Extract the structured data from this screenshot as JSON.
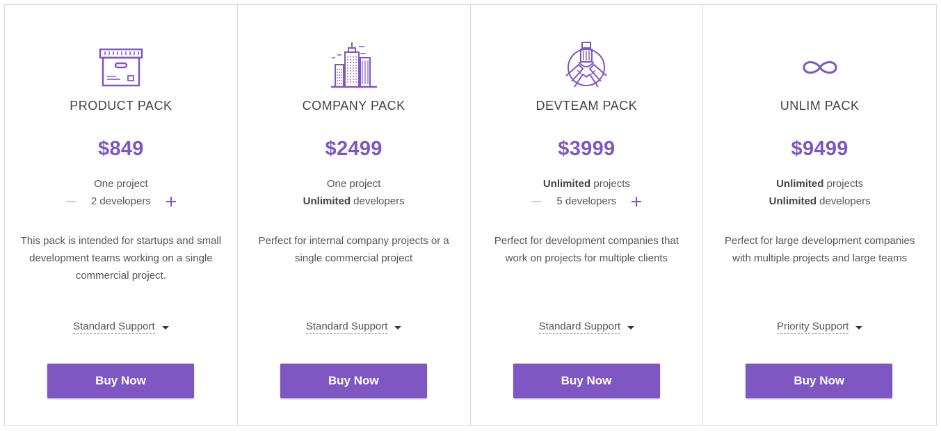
{
  "accent_color": "#7e57c2",
  "packs": [
    {
      "icon": "archive-box-icon",
      "title": "PRODUCT PACK",
      "price": "$849",
      "line1": {
        "text": "One project"
      },
      "line2": {
        "stepper": true,
        "count": "2 developers"
      },
      "description": "This pack is intended for startups and small development teams working on a single commercial project.",
      "support": "Standard Support",
      "button": "Buy Now"
    },
    {
      "icon": "office-buildings-icon",
      "title": "COMPANY PACK",
      "price": "$2499",
      "line1": {
        "text": "One project"
      },
      "line2": {
        "bold": "Unlimited",
        "rest": " developers"
      },
      "description": "Perfect for internal company projects or a single commercial project",
      "support": "Standard Support",
      "button": "Buy Now"
    },
    {
      "icon": "team-hands-icon",
      "title": "DEVTEAM PACK",
      "price": "$3999",
      "line1": {
        "bold": "Unlimited",
        "rest": " projects"
      },
      "line2": {
        "stepper": true,
        "count": "5 developers"
      },
      "description": "Perfect for development companies that work on projects for multiple clients",
      "support": "Standard Support",
      "button": "Buy Now"
    },
    {
      "icon": "infinity-icon",
      "title": "UNLIM PACK",
      "price": "$9499",
      "line1": {
        "bold": "Unlimited",
        "rest": " projects"
      },
      "line2": {
        "bold": "Unlimited",
        "rest": " developers"
      },
      "description": "Perfect for large development companies with multiple projects and large teams",
      "support": "Priority Support",
      "button": "Buy Now"
    }
  ]
}
